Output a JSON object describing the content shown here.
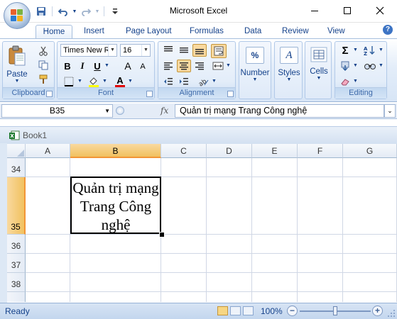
{
  "window": {
    "title": "Microsoft Excel"
  },
  "tabs": [
    "Home",
    "Insert",
    "Page Layout",
    "Formulas",
    "Data",
    "Review",
    "View"
  ],
  "help": "?",
  "ribbon": {
    "clipboard": {
      "label": "Clipboard",
      "paste": "Paste"
    },
    "font": {
      "label": "Font",
      "font_name": "Times New Ro",
      "font_size": "16",
      "bold": "B",
      "italic": "I",
      "underline": "U",
      "font_color_glyph": "A",
      "grow": "A",
      "shrink": "A"
    },
    "alignment": {
      "label": "Alignment"
    },
    "number": {
      "label": "Number",
      "glyph": "%"
    },
    "styles": {
      "label": "Styles",
      "glyph": "A"
    },
    "cells": {
      "label": "Cells"
    },
    "editing": {
      "label": "Editing",
      "sum": "Σ"
    }
  },
  "formula_bar": {
    "name_box": "B35",
    "fx": "fx",
    "value": "Quản trị mạng Trang Công nghệ"
  },
  "workbook": {
    "name": "Book1"
  },
  "columns": [
    "A",
    "B",
    "C",
    "D",
    "E",
    "F",
    "G"
  ],
  "selected_column": "B",
  "rows": [
    "34",
    "35",
    "36",
    "37",
    "38"
  ],
  "selected_row": "35",
  "cell_B35": {
    "line1": "Quản trị mạng",
    "line2": "Trang Công",
    "line3": "nghệ"
  },
  "status": {
    "ready": "Ready",
    "zoom": "100%",
    "zoom_fraction": 0.5
  },
  "colors": {
    "accent": "#15428b",
    "selection": "#f1c15f",
    "ribbon": "#dbe7f6"
  }
}
